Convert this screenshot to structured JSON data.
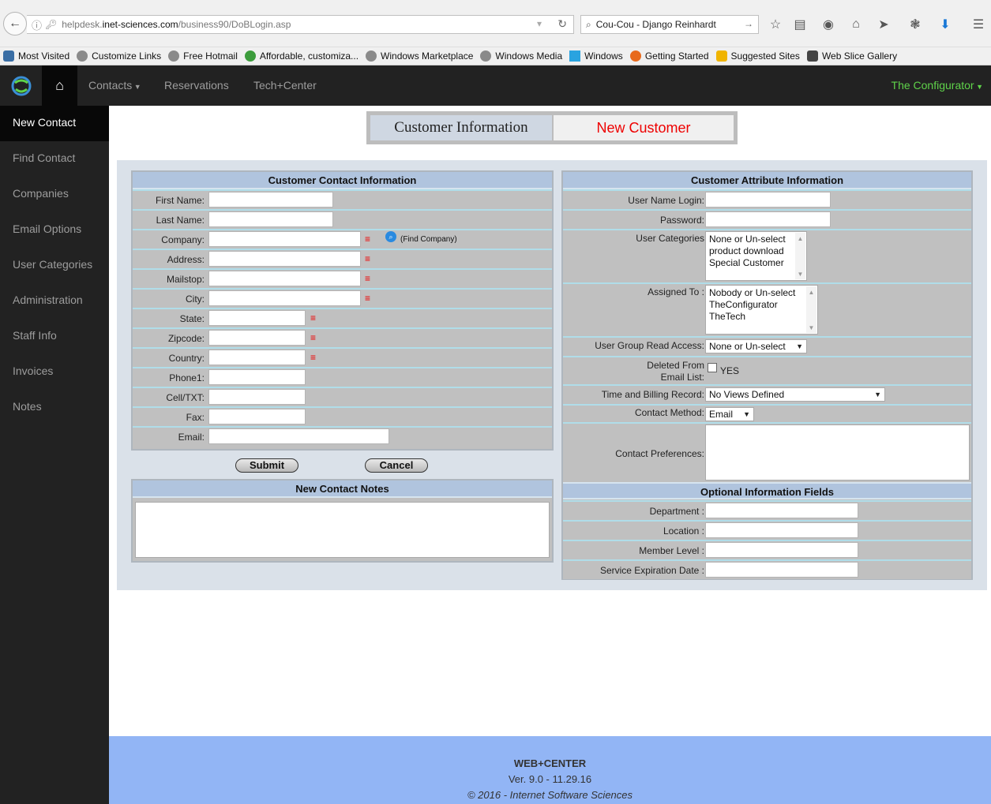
{
  "browser": {
    "url_prefix": "helpdesk.",
    "url_domain": "inet-sciences.com",
    "url_path": "/business90/DoBLogin.asp",
    "search_text": "Cou-Cou - Django Reinhardt",
    "bookmarks": [
      "Most Visited",
      "Customize Links",
      "Free Hotmail",
      "Affordable, customiza...",
      "Windows Marketplace",
      "Windows Media",
      "Windows",
      "Getting Started",
      "Suggested Sites",
      "Web Slice Gallery"
    ]
  },
  "nav": {
    "contacts": "Contacts",
    "reservations": "Reservations",
    "techcenter": "Tech+Center",
    "user": "The Configurator"
  },
  "sidebar": [
    "New Contact",
    "Find Contact",
    "Companies",
    "Email Options",
    "User Categories",
    "Administration",
    "Staff Info",
    "Invoices",
    "Notes"
  ],
  "header": {
    "tab1": "Customer Information",
    "tab2": "New Customer"
  },
  "contact": {
    "title": "Customer Contact Information",
    "first_name": "First Name:",
    "last_name": "Last Name:",
    "company": "Company:",
    "find_company": "(Find Company)",
    "address": "Address:",
    "mailstop": "Mailstop:",
    "city": "City:",
    "state": "State:",
    "zipcode": "Zipcode:",
    "country": "Country:",
    "phone1": "Phone1:",
    "cell": "Cell/TXT:",
    "fax": "Fax:",
    "email": "Email:",
    "required_mark": "≡"
  },
  "buttons": {
    "submit": "Submit",
    "cancel": "Cancel"
  },
  "notes": {
    "title": "New Contact Notes"
  },
  "attributes": {
    "title": "Customer Attribute Information",
    "user_login": "User Name Login:",
    "password": "Password:",
    "user_categories": "User Categories",
    "user_categories_options": [
      "None or Un-select",
      "product download",
      "Special Customer"
    ],
    "assigned_to": "Assigned To :",
    "assigned_to_options": [
      "Nobody or Un-select",
      "TheConfigurator",
      "TheTech"
    ],
    "group_read": "User Group Read Access:",
    "group_read_value": "None or Un-select",
    "deleted_label1": "Deleted From",
    "deleted_label2": "Email List:",
    "deleted_yes": "YES",
    "time_billing": "Time and Billing Record:",
    "time_billing_value": "No Views Defined",
    "contact_method": "Contact Method:",
    "contact_method_value": "Email",
    "contact_prefs": "Contact Preferences:"
  },
  "optional": {
    "title": "Optional Information Fields",
    "department": "Department :",
    "location": "Location :",
    "member_level": "Member Level :",
    "service_exp": "Service Expiration Date :"
  },
  "footer": {
    "product": "WEB+CENTER",
    "version": "Ver. 9.0 - 11.29.16",
    "copyright": "© 2016 - Internet Software Sciences"
  },
  "colors": {
    "nav_bg": "#222222",
    "user_link": "#5fd34a",
    "new_customer": "#ee0000",
    "panel_title": "#b0c4de",
    "footer_bg": "#92b5f5"
  }
}
